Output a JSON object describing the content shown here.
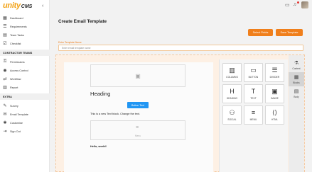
{
  "brand": {
    "logo_main": "unity",
    "logo_suffix": "CMS",
    "accent": "#f07f1b"
  },
  "sidebar": {
    "items": [
      {
        "label": "Dashboard",
        "icon": "dashboard-icon"
      },
      {
        "label": "Requirements",
        "icon": "requirements-icon"
      },
      {
        "label": "Team Tasks",
        "icon": "tasks-icon"
      },
      {
        "label": "Checklist",
        "icon": "checklist-icon"
      }
    ],
    "section_contractor": "CONTRACTOR TEAMS",
    "contractor_items": [
      {
        "label": "Permissions",
        "icon": "permissions-icon"
      },
      {
        "label": "Access Control",
        "icon": "access-control-icon"
      },
      {
        "label": "Workflow",
        "icon": "workflow-icon"
      },
      {
        "label": "Report",
        "icon": "report-icon"
      }
    ],
    "section_extra": "EXTRA",
    "extra_items": [
      {
        "label": "Survey",
        "icon": "survey-icon"
      },
      {
        "label": "Email Template",
        "icon": "email-icon"
      },
      {
        "label": "Customise",
        "icon": "customise-icon"
      },
      {
        "label": "Sign Out",
        "icon": "sign-out-icon"
      }
    ]
  },
  "page": {
    "title": "Create Email Template",
    "select_fields": "Select Fields",
    "save_template": "Save Template",
    "template_name_label": "Enter Template Name",
    "template_name_placeholder": "Enter email template name"
  },
  "canvas": {
    "heading": "Heading",
    "button_text": "Button Text",
    "text_block": "This is a new Text block. Change the text.",
    "menu_label": "Menu",
    "hello": "Hello, world!"
  },
  "blocks": [
    {
      "label": "COLUMNS",
      "icon": "columns-icon"
    },
    {
      "label": "BUTTON",
      "icon": "button-icon"
    },
    {
      "label": "DIVIDER",
      "icon": "divider-icon"
    },
    {
      "label": "HEADING",
      "icon": "heading-icon"
    },
    {
      "label": "TEXT",
      "icon": "text-icon"
    },
    {
      "label": "IMAGE",
      "icon": "image-icon"
    },
    {
      "label": "SOCIAL",
      "icon": "social-icon"
    },
    {
      "label": "MENU",
      "icon": "menu-icon"
    },
    {
      "label": "HTML",
      "icon": "html-icon"
    }
  ],
  "tabs": [
    {
      "label": "Content",
      "icon": "content-icon"
    },
    {
      "label": "Blocks",
      "icon": "blocks-icon"
    },
    {
      "label": "Body",
      "icon": "body-icon"
    }
  ]
}
